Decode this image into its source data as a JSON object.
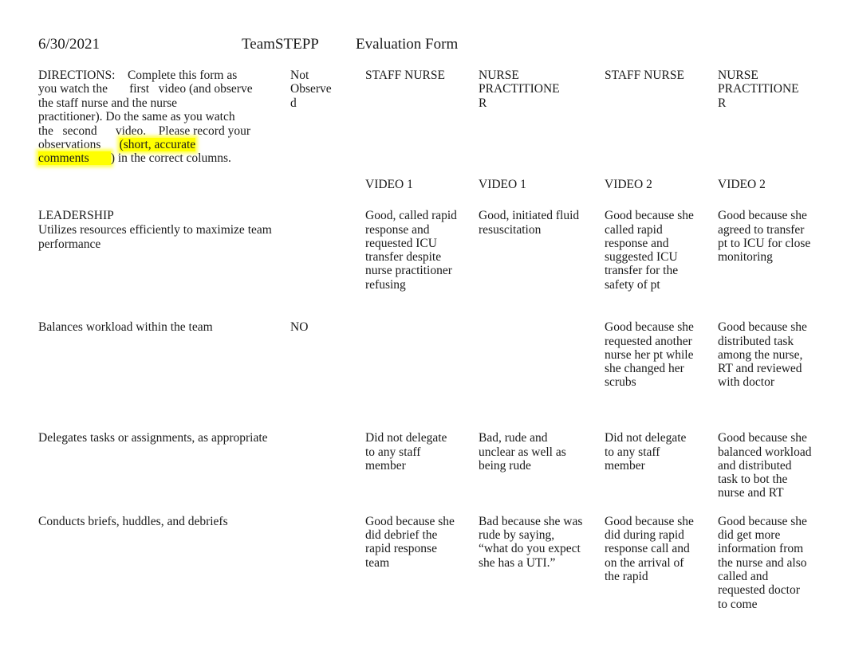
{
  "document": {
    "date": "6/30/2021",
    "title": "TeamSTEPP",
    "subtitle": "Evaluation Form"
  },
  "directions": {
    "line1": "DIRECTIONS:    Complete this form as",
    "line2": "you watch the       first   video (and observe",
    "line3": "the staff nurse and the nurse",
    "line4": "practitioner). Do the same as you watch",
    "line5": "the   second      video.    Please record your",
    "line6_plain": "observations      ",
    "line6_highlight": "(short, accurate",
    "line7_highlight": "comments       ",
    "line7_plain": ") in the correct columns.",
    "highlight_color": "#ffff00"
  },
  "columns": [
    {
      "key": "criteria",
      "label": ""
    },
    {
      "key": "not_observed",
      "label": "Not Observe\nd",
      "label_l1": "Not",
      "label_l2": "Observe",
      "label_l3": "d"
    },
    {
      "key": "v1_staff_nurse",
      "label_l1": "STAFF NURSE",
      "video": "VIDEO 1"
    },
    {
      "key": "v1_nurse_practitioner",
      "label_l1": "NURSE",
      "label_l2": "PRACTITIONE",
      "label_l3": "R",
      "video": "VIDEO 1"
    },
    {
      "key": "v2_staff_nurse",
      "label_l1": "STAFF NURSE",
      "video": "VIDEO 2"
    },
    {
      "key": "v2_nurse_practitioner",
      "label_l1": "NURSE",
      "label_l2": "PRACTITIONE",
      "label_l3": "R",
      "video": "VIDEO 2"
    }
  ],
  "section": {
    "heading": "LEADERSHIP"
  },
  "rows": [
    {
      "criteria": "Utilizes resources efficiently to maximize team performance",
      "not_observed": "",
      "v1_staff_nurse": "Good, called rapid response and requested ICU transfer despite nurse practitioner refusing",
      "v1_nurse_practitioner": "Good, initiated fluid resuscitation",
      "v2_staff_nurse": "Good because she called rapid response and suggested ICU transfer for the safety of pt",
      "v2_nurse_practitioner": "Good because she agreed to transfer pt to ICU for close monitoring"
    },
    {
      "criteria": "Balances workload within the team",
      "not_observed": "NO",
      "v1_staff_nurse": "",
      "v1_nurse_practitioner": "",
      "v2_staff_nurse": "Good because she requested another nurse her pt while she changed her scrubs",
      "v2_nurse_practitioner": "Good because she distributed task among the nurse, RT and reviewed with doctor"
    },
    {
      "criteria": "Delegates tasks or assignments, as appropriate",
      "not_observed": "",
      "v1_staff_nurse": "Did not delegate to any staff member",
      "v1_nurse_practitioner": "Bad, rude and unclear as well as being rude",
      "v2_staff_nurse": "Did not delegate to any staff member",
      "v2_nurse_practitioner": "Good because she balanced workload and distributed task to bot the nurse and RT"
    },
    {
      "criteria": "Conducts briefs, huddles, and debriefs",
      "not_observed": "",
      "v1_staff_nurse": "Good because she did debrief the rapid response team",
      "v1_nurse_practitioner": "Bad because she was rude by saying, “what do you expect she has a UTI.”",
      "v2_staff_nurse": "Good because she did during rapid response call and on the arrival of the rapid",
      "v2_nurse_practitioner": "Good because she did get more information from the nurse and also called and requested doctor to come"
    }
  ]
}
